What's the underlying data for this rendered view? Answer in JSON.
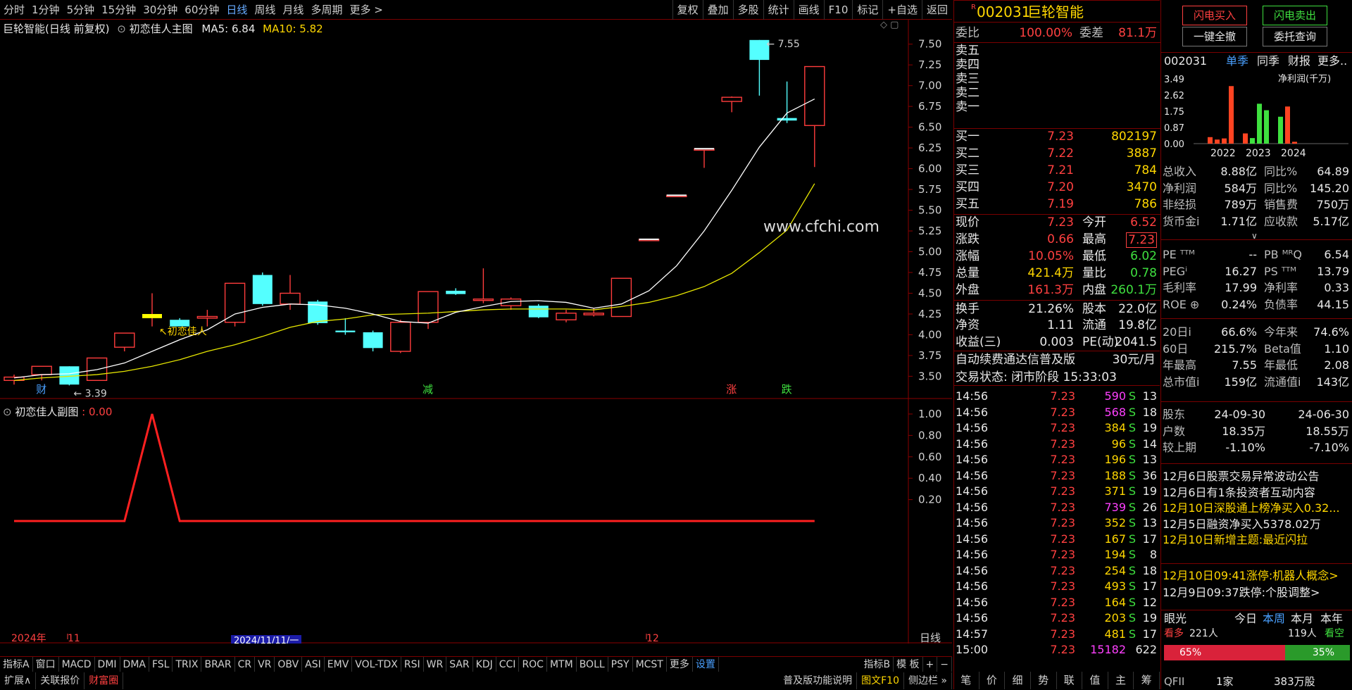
{
  "toolbar": {
    "periods": [
      "分时",
      "1分钟",
      "5分钟",
      "15分钟",
      "30分钟",
      "60分钟",
      "日线",
      "周线",
      "月线",
      "多周期",
      "更多 >"
    ],
    "selected": "日线",
    "right": [
      "复权",
      "叠加",
      "多股",
      "统计",
      "画线",
      "F10",
      "标记",
      "+自选",
      "返回"
    ]
  },
  "main_chart": {
    "title": "巨轮智能(日线 前复权)",
    "indicator": "初恋佳人主图",
    "ma5": "MA5: 6.84",
    "ma10": "MA10: 5.82",
    "y_ticks": [
      "7.50",
      "7.25",
      "7.00",
      "6.75",
      "6.50",
      "6.25",
      "6.00",
      "5.75",
      "5.50",
      "5.25",
      "5.00",
      "4.75",
      "4.50",
      "4.25",
      "4.00",
      "3.75",
      "3.50"
    ],
    "high_label": "7.55",
    "low_label": "3.39",
    "signal_label": "初恋佳人",
    "watermark": "www.cfchi.com",
    "markers": [
      {
        "text": "财",
        "color": "#4aa0ff"
      },
      {
        "text": "减",
        "color": "#3fe03f"
      },
      {
        "text": "涨",
        "color": "#ff4040"
      },
      {
        "text": "跌",
        "color": "#3fe03f"
      }
    ]
  },
  "chart_data": {
    "type": "candlestick",
    "ylim": [
      3.3,
      7.65
    ],
    "candles": [
      {
        "o": 3.45,
        "h": 3.52,
        "l": 3.4,
        "c": 3.49
      },
      {
        "o": 3.52,
        "h": 3.6,
        "l": 3.45,
        "c": 3.62
      },
      {
        "o": 3.62,
        "h": 3.62,
        "l": 3.39,
        "c": 3.4
      },
      {
        "o": 3.45,
        "h": 3.72,
        "l": 3.45,
        "c": 3.72
      },
      {
        "o": 3.85,
        "h": 4.02,
        "l": 3.8,
        "c": 4.02
      },
      {
        "o": 4.2,
        "h": 4.5,
        "l": 4.1,
        "c": 4.25
      },
      {
        "o": 4.18,
        "h": 4.2,
        "l": 4.1,
        "c": 4.1
      },
      {
        "o": 4.2,
        "h": 4.3,
        "l": 4.1,
        "c": 4.22
      },
      {
        "o": 4.15,
        "h": 4.62,
        "l": 4.1,
        "c": 4.62
      },
      {
        "o": 4.72,
        "h": 4.75,
        "l": 4.35,
        "c": 4.37
      },
      {
        "o": 4.37,
        "h": 4.72,
        "l": 4.3,
        "c": 4.5
      },
      {
        "o": 4.4,
        "h": 4.42,
        "l": 4.12,
        "c": 4.14
      },
      {
        "o": 4.05,
        "h": 4.2,
        "l": 4.0,
        "c": 4.03
      },
      {
        "o": 4.03,
        "h": 4.05,
        "l": 3.8,
        "c": 3.84
      },
      {
        "o": 3.8,
        "h": 4.18,
        "l": 3.78,
        "c": 4.15
      },
      {
        "o": 4.15,
        "h": 4.52,
        "l": 4.07,
        "c": 4.52
      },
      {
        "o": 4.53,
        "h": 4.56,
        "l": 4.48,
        "c": 4.49
      },
      {
        "o": 4.43,
        "h": 4.8,
        "l": 4.38,
        "c": 4.43
      },
      {
        "o": 4.35,
        "h": 4.45,
        "l": 4.3,
        "c": 4.43
      },
      {
        "o": 4.35,
        "h": 4.37,
        "l": 4.2,
        "c": 4.21
      },
      {
        "o": 4.18,
        "h": 4.3,
        "l": 4.15,
        "c": 4.26
      },
      {
        "o": 4.24,
        "h": 4.32,
        "l": 4.22,
        "c": 4.26
      },
      {
        "o": 4.22,
        "h": 4.68,
        "l": 4.22,
        "c": 4.68
      },
      {
        "o": 5.15,
        "h": 5.15,
        "l": 5.15,
        "c": 5.15
      },
      {
        "o": 5.68,
        "h": 5.68,
        "l": 5.68,
        "c": 5.68
      },
      {
        "o": 6.24,
        "h": 6.24,
        "l": 6.01,
        "c": 6.24
      },
      {
        "o": 6.81,
        "h": 6.87,
        "l": 6.68,
        "c": 6.86
      },
      {
        "o": 7.55,
        "h": 7.55,
        "l": 6.88,
        "c": 7.31
      },
      {
        "o": 6.61,
        "h": 7.05,
        "l": 6.55,
        "c": 6.58
      },
      {
        "o": 6.52,
        "h": 7.23,
        "l": 6.02,
        "c": 7.23
      }
    ],
    "ma5": [
      3.48,
      3.52,
      3.53,
      3.58,
      3.66,
      3.8,
      3.94,
      4.06,
      4.25,
      4.33,
      4.37,
      4.36,
      4.32,
      4.25,
      4.16,
      4.14,
      4.27,
      4.34,
      4.4,
      4.41,
      4.39,
      4.32,
      4.37,
      4.53,
      4.83,
      5.25,
      5.74,
      6.26,
      6.67,
      6.84
    ],
    "ma10": [
      3.45,
      3.48,
      3.5,
      3.52,
      3.56,
      3.62,
      3.7,
      3.8,
      3.88,
      3.98,
      4.09,
      4.16,
      4.19,
      4.24,
      4.25,
      4.26,
      4.28,
      4.3,
      4.31,
      4.31,
      4.31,
      4.3,
      4.34,
      4.39,
      4.47,
      4.58,
      4.74,
      4.99,
      5.26,
      5.82
    ]
  },
  "sub_chart": {
    "title": "初恋佳人副图",
    "value": ": 0.00",
    "y_ticks": [
      "1.00",
      "0.80",
      "0.60",
      "0.40",
      "0.20"
    ],
    "values": [
      0,
      0,
      0,
      0,
      0,
      1,
      0,
      0,
      0,
      0,
      0,
      0,
      0,
      0,
      0,
      0,
      0,
      0,
      0,
      0,
      0,
      0,
      0,
      0,
      0,
      0,
      0,
      0,
      0,
      0
    ]
  },
  "date_axis": {
    "year": "2024年",
    "m11": "11",
    "cursor": "2024/11/11/一",
    "m12": "12",
    "label": "日线"
  },
  "bottom_tabs": [
    "指标A",
    "窗口",
    "MACD",
    "DMI",
    "DMA",
    "FSL",
    "TRIX",
    "BRAR",
    "CR",
    "VR",
    "OBV",
    "ASI",
    "EMV",
    "VOL-TDX",
    "RSI",
    "WR",
    "SAR",
    "KDJ",
    "CCI",
    "ROC",
    "MTM",
    "BOLL",
    "PSY",
    "MCST",
    "更多",
    "设置"
  ],
  "bottom_right_tabs": [
    "指标B",
    "模 板",
    "+",
    "−"
  ],
  "bottom_bar2": [
    "扩展∧",
    "关联报价",
    "财富圈"
  ],
  "bottom_bar2_right": [
    "普及版功能说明",
    "图文F10",
    "侧边栏 »"
  ],
  "quote": {
    "code": "002031",
    "name": "巨轮智能",
    "wb_label": "委比",
    "wb": "100.00%",
    "wc_label": "委差",
    "wc": "81.1万",
    "sell": [
      "卖五",
      "卖四",
      "卖三",
      "卖二",
      "卖一"
    ],
    "buy": [
      {
        "l": "买一",
        "p": "7.23",
        "v": "802197"
      },
      {
        "l": "买二",
        "p": "7.22",
        "v": "3887"
      },
      {
        "l": "买三",
        "p": "7.21",
        "v": "784"
      },
      {
        "l": "买四",
        "p": "7.20",
        "v": "3470"
      },
      {
        "l": "买五",
        "p": "7.19",
        "v": "786"
      }
    ],
    "stats": [
      {
        "a": "现价",
        "b": "7.23",
        "c": "今开",
        "d": "6.52",
        "bc": "red",
        "dc": "red"
      },
      {
        "a": "涨跌",
        "b": "0.66",
        "c": "最高",
        "d": "7.23",
        "bc": "red",
        "dc": "red"
      },
      {
        "a": "涨幅",
        "b": "10.05%",
        "c": "最低",
        "d": "6.02",
        "bc": "red",
        "dc": "grn"
      },
      {
        "a": "总量",
        "b": "421.4万",
        "c": "量比",
        "d": "0.78",
        "bc": "yel",
        "dc": "grn"
      },
      {
        "a": "外盘",
        "b": "161.3万",
        "c": "内盘",
        "d": "260.1万",
        "bc": "red",
        "dc": "grn"
      }
    ],
    "stats2": [
      {
        "a": "换手",
        "b": "21.26%",
        "c": "股本",
        "d": "22.0亿"
      },
      {
        "a": "净资",
        "b": "1.11",
        "c": "流通",
        "d": "19.8亿"
      },
      {
        "a": "收益(三)",
        "b": "0.003",
        "c": "PE(动)",
        "d": "2041.5"
      }
    ],
    "ad": "自动续费通达信普及版",
    "ad_price": "30元/月",
    "status": "交易状态: 闭市阶段 15:33:03",
    "ticks": [
      {
        "t": "14:56",
        "p": "7.23",
        "v": "590",
        "s": "S",
        "n": "13",
        "m": 1
      },
      {
        "t": "14:56",
        "p": "7.23",
        "v": "568",
        "s": "S",
        "n": "18",
        "m": 1
      },
      {
        "t": "14:56",
        "p": "7.23",
        "v": "384",
        "s": "S",
        "n": "19",
        "m": 0
      },
      {
        "t": "14:56",
        "p": "7.23",
        "v": "96",
        "s": "S",
        "n": "14",
        "m": 0
      },
      {
        "t": "14:56",
        "p": "7.23",
        "v": "196",
        "s": "S",
        "n": "13",
        "m": 0
      },
      {
        "t": "14:56",
        "p": "7.23",
        "v": "188",
        "s": "S",
        "n": "36",
        "m": 0
      },
      {
        "t": "14:56",
        "p": "7.23",
        "v": "371",
        "s": "S",
        "n": "19",
        "m": 0
      },
      {
        "t": "14:56",
        "p": "7.23",
        "v": "739",
        "s": "S",
        "n": "26",
        "m": 1
      },
      {
        "t": "14:56",
        "p": "7.23",
        "v": "352",
        "s": "S",
        "n": "13",
        "m": 0
      },
      {
        "t": "14:56",
        "p": "7.23",
        "v": "167",
        "s": "S",
        "n": "17",
        "m": 0
      },
      {
        "t": "14:56",
        "p": "7.23",
        "v": "194",
        "s": "S",
        "n": "8",
        "m": 0
      },
      {
        "t": "14:56",
        "p": "7.23",
        "v": "254",
        "s": "S",
        "n": "18",
        "m": 0
      },
      {
        "t": "14:56",
        "p": "7.23",
        "v": "493",
        "s": "S",
        "n": "17",
        "m": 0
      },
      {
        "t": "14:56",
        "p": "7.23",
        "v": "164",
        "s": "S",
        "n": "12",
        "m": 0
      },
      {
        "t": "14:56",
        "p": "7.23",
        "v": "203",
        "s": "S",
        "n": "19",
        "m": 0
      },
      {
        "t": "14:57",
        "p": "7.23",
        "v": "481",
        "s": "S",
        "n": "17",
        "m": 0
      },
      {
        "t": "15:00",
        "p": "7.23",
        "v": "15182",
        "s": "",
        "n": "622",
        "m": 1
      }
    ],
    "tabs": [
      "笔",
      "价",
      "细",
      "势",
      "联",
      "值",
      "主",
      "筹"
    ]
  },
  "right": {
    "btn_buy": "闪电买入",
    "btn_sell": "闪电卖出",
    "btn_cancel": "一键全撤",
    "btn_query": "委托查询",
    "code": "002031",
    "t1": "单季",
    "t2": "同季",
    "t3": "财报",
    "t4": "更多..",
    "profit_label": "净利润(千万)",
    "profit_yticks": [
      "3.49",
      "2.62",
      "1.75",
      "0.87",
      "0.00"
    ],
    "profit_years": [
      "2022",
      "2023",
      "2024"
    ],
    "profit_bars": [
      {
        "v": 0.35,
        "c": "#ff4422"
      },
      {
        "v": 0.22,
        "c": "#ff4422"
      },
      {
        "v": 0.28,
        "c": "#ff4422"
      },
      {
        "v": 3.1,
        "c": "#ff4422"
      },
      {
        "v": 0.55,
        "c": "#ff4422"
      },
      {
        "v": 0.3,
        "c": "#3fe03f"
      },
      {
        "v": 2.15,
        "c": "#3fe03f"
      },
      {
        "v": 1.8,
        "c": "#3fe03f"
      },
      {
        "v": 1.45,
        "c": "#3fe03f"
      },
      {
        "v": 2.0,
        "c": "#ff4422"
      },
      {
        "v": 0.1,
        "c": "#ff4422"
      }
    ],
    "fin": [
      {
        "a": "总收入",
        "b": "8.88亿",
        "c": "同比%",
        "d": "64.89"
      },
      {
        "a": "净利润",
        "b": "584万",
        "c": "同比%",
        "d": "145.20"
      },
      {
        "a": "非经损",
        "b": "789万",
        "c": "销售费",
        "d": "750万"
      },
      {
        "a": "货币金i",
        "b": "1.71亿",
        "c": "应收款",
        "d": "5.17亿"
      }
    ],
    "fin2": [
      {
        "a": "PE ᵀᵀᴹ",
        "b": "--",
        "c": "PB ᴹᴿQ",
        "d": "6.54"
      },
      {
        "a": "PEGⁱ",
        "b": "16.27",
        "c": "PS ᵀᵀᴹ",
        "d": "13.79"
      },
      {
        "a": "毛利率",
        "b": "17.99",
        "c": "净利率",
        "d": "0.33"
      },
      {
        "a": "ROE ⊕",
        "b": "0.24%",
        "c": "负债率",
        "d": "44.15"
      }
    ],
    "fin3": [
      {
        "a": "20日i",
        "b": "66.6%",
        "c": "今年来",
        "d": "74.6%"
      },
      {
        "a": "60日",
        "b": "215.7%",
        "c": "Beta值",
        "d": "1.10"
      },
      {
        "a": "年最高",
        "b": "7.55",
        "c": "年最低",
        "d": "2.08"
      },
      {
        "a": "总市值i",
        "b": "159亿",
        "c": "流通值i",
        "d": "143亿"
      }
    ],
    "holders": [
      {
        "a": "股东",
        "b": "24-09-30",
        "d": "24-06-30"
      },
      {
        "a": "户数",
        "b": "18.35万",
        "d": "18.55万"
      },
      {
        "a": "较上期",
        "b": "-1.10%",
        "d": "-7.10%"
      }
    ],
    "news": [
      {
        "t": "12月6日股票交易异常波动公告",
        "c": "wht"
      },
      {
        "t": "12月6日有1条投资者互动内容",
        "c": "wht"
      },
      {
        "t": "12月10日深股通上榜净买入0.32...",
        "c": "yel"
      },
      {
        "t": "12月5日融资净买入5378.02万",
        "c": "wht"
      },
      {
        "t": "12月10日新增主题:最近闪拉",
        "c": "yel"
      }
    ],
    "news2": [
      {
        "t": "12月10日09:41涨停:机器人概念>",
        "c": "yel"
      },
      {
        "t": "12月9日09:37跌停:个股调整>",
        "c": "wht"
      }
    ],
    "eye": "眼光",
    "today": "今日",
    "week": "本周",
    "month": "本月",
    "year": "本年",
    "bull": "看多",
    "bull_n": "221人",
    "bear_n": "119人",
    "bear": "看空",
    "bull_pct": "65%",
    "bear_pct": "35%",
    "qfii": "QFII",
    "qfii_n": "1家",
    "qfii_v": "383万股"
  }
}
